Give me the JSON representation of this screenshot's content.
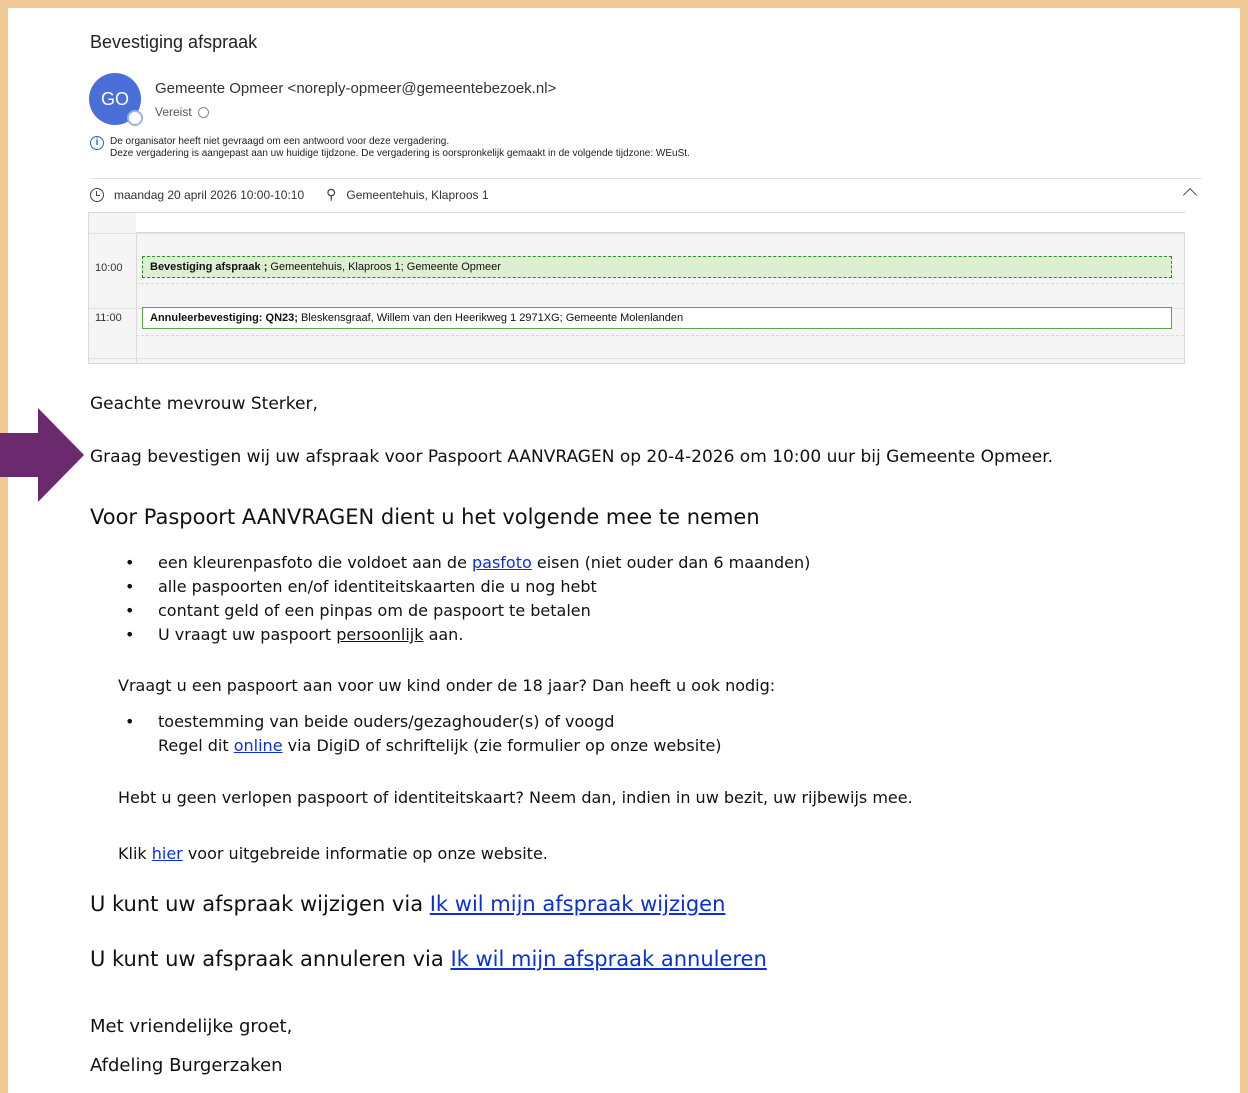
{
  "email": {
    "subject": "Bevestiging afspraak",
    "avatar_initials": "GO",
    "sender": "Gemeente Opmeer <noreply-opmeer@gemeentebezoek.nl>",
    "required_label": "Vereist",
    "info_line_1": "De organisator heeft niet gevraagd om een antwoord voor deze vergadering.",
    "info_line_2": "Deze vergadering is aangepast aan uw huidige tijdzone. De vergadering is oorspronkelijk gemaakt in de volgende tijdzone: WEuSt.",
    "datetime": "maandag 20 april 2026 10:00-10:10",
    "location": "Gemeentehuis, Klaproos 1"
  },
  "calendar": {
    "time_1": "10:00",
    "time_2": "11:00",
    "event_1_title": "Bevestiging afspraak ;",
    "event_1_details": " Gemeentehuis, Klaproos 1; Gemeente Opmeer",
    "event_2_title": "Annuleerbevestiging: QN23;",
    "event_2_details": " Bleskensgraaf, Willem van den Heerikweg 1 2971XG; Gemeente Molenlanden"
  },
  "body": {
    "greeting": "Geachte mevrouw Sterker,",
    "confirmation": "Graag bevestigen wij uw afspraak voor Paspoort AANVRAGEN op 20-4-2026 om 10:00 uur bij Gemeente Opmeer.",
    "heading": "Voor Paspoort AANVRAGEN dient u het volgende mee te nemen",
    "item_1_pre": "een kleurenpasfoto die voldoet aan de ",
    "item_1_link": "pasfoto",
    "item_1_post": " eisen (niet ouder dan 6 maanden)",
    "item_2": "alle paspoorten en/of identiteitskaarten die u nog hebt",
    "item_3": "contant geld of een pinpas om de paspoort te betalen",
    "item_4_pre": "U vraagt uw paspoort ",
    "item_4_underline": "persoonlijk",
    "item_4_post": " aan.",
    "child_question": "Vraagt u een paspoort aan voor uw kind onder de 18 jaar? Dan heeft u ook nodig:",
    "child_item_line_1": "toestemming van beide ouders/gezaghouder(s) of voogd",
    "child_item_pre": "Regel dit ",
    "child_item_link": "online",
    "child_item_post": " via DigiD of schriftelijk (zie formulier op onze website)",
    "expired": "Hebt u geen verlopen paspoort of identiteitskaart? Neem dan, indien in uw bezit, uw rijbewijs mee.",
    "click_pre": "Klik ",
    "click_link": "hier",
    "click_post": " voor uitgebreide informatie op onze website.",
    "change_pre": "U kunt uw afspraak wijzigen via ",
    "change_link": "Ik wil mijn afspraak wijzigen",
    "cancel_pre": "U kunt uw afspraak annuleren via ",
    "cancel_link": "Ik wil mijn afspraak annuleren",
    "closing": "Met vriendelijke groet,",
    "department": "Afdeling Burgerzaken"
  },
  "colors": {
    "frame": "#f0c895",
    "avatar": "#4a6fd8",
    "arrow": "#6b2a6e",
    "link": "#0b2fd6",
    "event_busy_bg": "#dcefd0",
    "event_border": "#58a644"
  },
  "icons": [
    "info-icon",
    "clock-icon",
    "location-pin-icon",
    "chevron-up-icon",
    "arrow-right-icon"
  ]
}
